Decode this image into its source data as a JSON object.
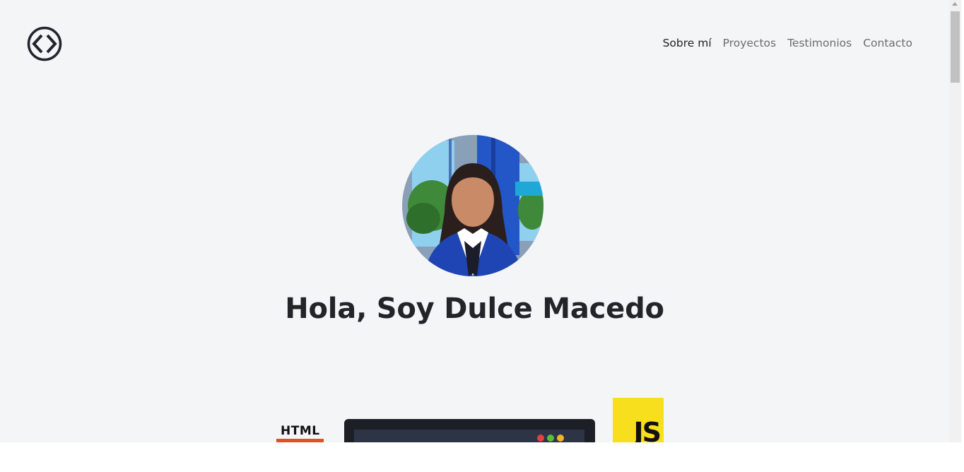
{
  "nav": {
    "logo_icon": "code-brackets-icon",
    "items": [
      {
        "label": "Sobre mí",
        "active": true
      },
      {
        "label": "Proyectos",
        "active": false
      },
      {
        "label": "Testimonios",
        "active": false
      },
      {
        "label": "Contacto",
        "active": false
      }
    ]
  },
  "hero": {
    "title": "Hola, Soy Dulce Macedo",
    "avatar": "profile-photo"
  },
  "tech": {
    "html_label": "HTML",
    "js_label": "JS"
  },
  "colors": {
    "background": "#f4f5f7",
    "text": "#212529",
    "nav_inactive": "#6c6c6c",
    "html_orange": "#e44d26",
    "js_yellow": "#f7df1e"
  }
}
